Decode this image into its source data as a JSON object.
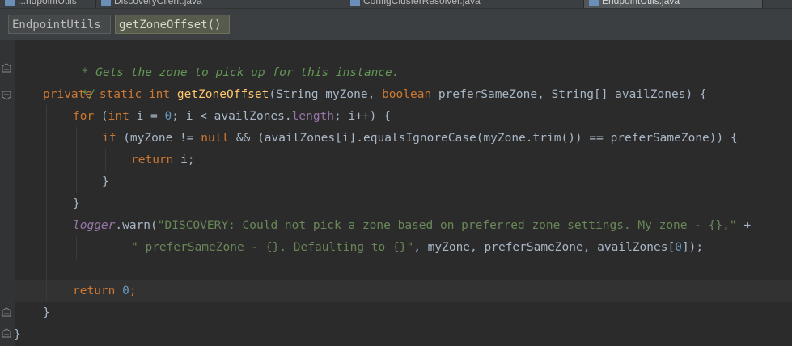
{
  "tabs": [
    {
      "label": "...ndpointUtils"
    },
    {
      "label": "DiscoveryClient.java"
    },
    {
      "label": "ConfigClusterResolver.java"
    },
    {
      "label": "EndpointUtils.java",
      "active": true
    }
  ],
  "breadcrumb": {
    "class_label": "EndpointUtils",
    "method_label": "getZoneOffset()"
  },
  "code": {
    "l1": {
      "doc": " * Gets the zone to pick up for this instance."
    },
    "l2": {
      "doc": " */"
    },
    "l3": {
      "kw1": "private static int ",
      "fn": "getZoneOffset",
      "p1": "(String myZone, ",
      "kw2": "boolean ",
      "p2": "preferSameZone, String[] availZones) {"
    },
    "l4": {
      "kw1": "for ",
      "p1": "(",
      "kw2": "int ",
      "p2": "i = ",
      "n1": "0",
      "p3": "; i < availZones.",
      "field": "length",
      "p4": "; i++) {"
    },
    "l5": {
      "kw1": "if ",
      "p1": "(myZone != ",
      "kw2": "null ",
      "p2": "&& (availZones[i].equalsIgnoreCase(myZone.trim()) == preferSameZone)) {"
    },
    "l6": {
      "kw": "return ",
      "p": "i;"
    },
    "l7": {
      "p": "}"
    },
    "l8": {
      "p": "}"
    },
    "l9": {
      "logger": "logger",
      "p1": ".warn(",
      "s1": "\"DISCOVERY: Could not pick a zone based on preferred zone settings. My zone - {},\"",
      "p2": " +"
    },
    "l10": {
      "s1": "\" preferSameZone - {}. Defaulting to {}\"",
      "p1": ", myZone, preferSameZone, availZones[",
      "n1": "0",
      "p2": "]);"
    },
    "l11": {
      "kw": "return ",
      "n": "0",
      "p": ";"
    },
    "l12": {
      "p": "}"
    },
    "l13": {
      "p": "}"
    }
  },
  "colors": {
    "background": "#2b2b2b",
    "keyword": "#cc7832",
    "number": "#6897bb",
    "string": "#6a8759",
    "method": "#ffc66d",
    "doc_comment": "#629755",
    "field": "#9876aa"
  }
}
